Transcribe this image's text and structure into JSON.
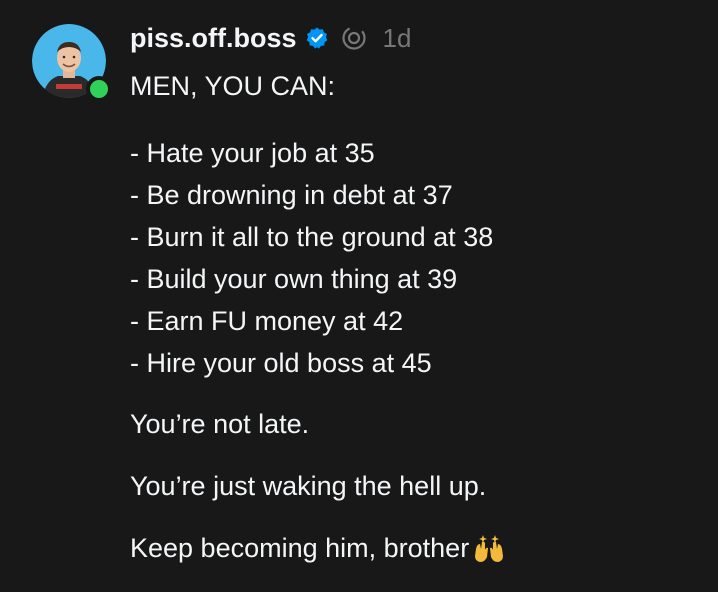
{
  "post": {
    "username": "piss.off.boss",
    "timestamp": "1d",
    "heading": "MEN, YOU CAN:",
    "list": [
      "- Hate your job at 35",
      "- Be drowning in debt at 37",
      "- Burn it all to the ground at 38",
      "- Build your own thing at 39",
      "- Earn FU money at 42",
      "- Hire your old boss at 45"
    ],
    "paragraph_1": "You’re not late.",
    "paragraph_2": "You’re just waking the hell up.",
    "paragraph_3": "Keep becoming him, brother",
    "emoji": "raised-hands-emoji"
  },
  "icons": {
    "verified": "verified-badge-icon",
    "threads": "threads-spiral-icon",
    "online": "online-status-dot"
  },
  "colors": {
    "background": "#181818",
    "text": "#f3f5f7",
    "muted": "#777777",
    "verified": "#0095f6",
    "online": "#2fd158",
    "avatar_bg": "#49b7ea"
  }
}
